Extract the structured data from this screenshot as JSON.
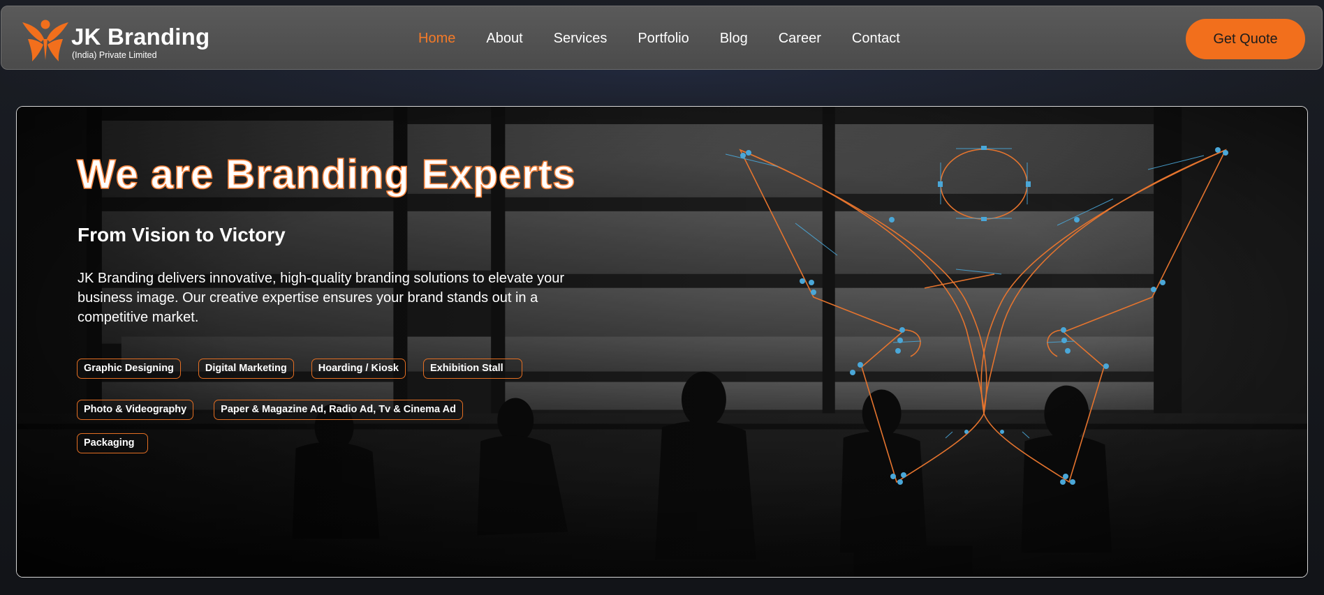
{
  "brand": {
    "name": "JK Branding",
    "subtitle": "(India) Private Limited",
    "accent_color": "#f26f1c",
    "logo_icon": "butterfly-figure-icon"
  },
  "nav": {
    "items": [
      {
        "label": "Home",
        "active": true
      },
      {
        "label": "About"
      },
      {
        "label": "Services"
      },
      {
        "label": "Portfolio"
      },
      {
        "label": "Blog"
      },
      {
        "label": "Career"
      },
      {
        "label": "Contact"
      }
    ],
    "cta_label": "Get Quote"
  },
  "hero": {
    "title": "We are Branding Experts",
    "subtitle": "From Vision to Victory",
    "description": "JK Branding delivers innovative, high-quality branding solutions to elevate your business image. Our creative expertise ensures your brand stands out in a competitive market.",
    "services": [
      "Graphic Designing",
      "Digital Marketing",
      "Hoarding / Kiosk",
      "Exhibition Stall",
      "Photo & Videography",
      "Paper & Magazine Ad, Radio Ad, Tv & Cinema Ad",
      "Packaging"
    ],
    "illustration_icon": "vector-path-butterfly-icon"
  }
}
